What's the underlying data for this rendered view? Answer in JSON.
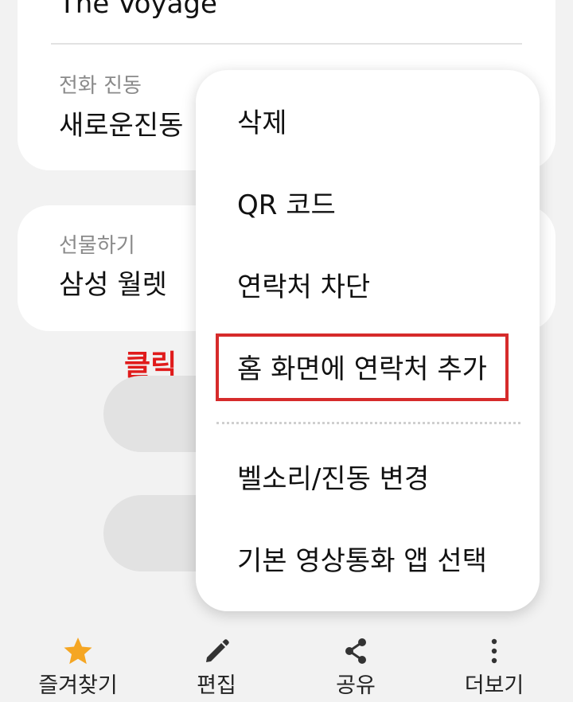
{
  "contact": {
    "title_partial": "The Voyage",
    "vibration_label": "전화 진동",
    "vibration_value": "새로운진동",
    "gift_label": "선물하기",
    "gift_value": "삼성 월렛"
  },
  "annotation": {
    "click_text": "클릭",
    "color": "#e01b1b",
    "highlight_color": "#d62b2b"
  },
  "menu": {
    "items": [
      {
        "label": "삭제"
      },
      {
        "label": "QR 코드"
      },
      {
        "label": "연락처 차단"
      },
      {
        "label": "홈 화면에 연락처 추가"
      },
      {
        "label": "벨소리/진동 변경"
      },
      {
        "label": "기본 영상통화 앱 선택"
      }
    ]
  },
  "bottom_nav": {
    "items": [
      {
        "label": "즐겨찾기",
        "icon": "star-icon"
      },
      {
        "label": "편집",
        "icon": "pencil-icon"
      },
      {
        "label": "공유",
        "icon": "share-icon"
      },
      {
        "label": "더보기",
        "icon": "more-vertical-icon"
      }
    ],
    "star_color": "#f5a623"
  }
}
